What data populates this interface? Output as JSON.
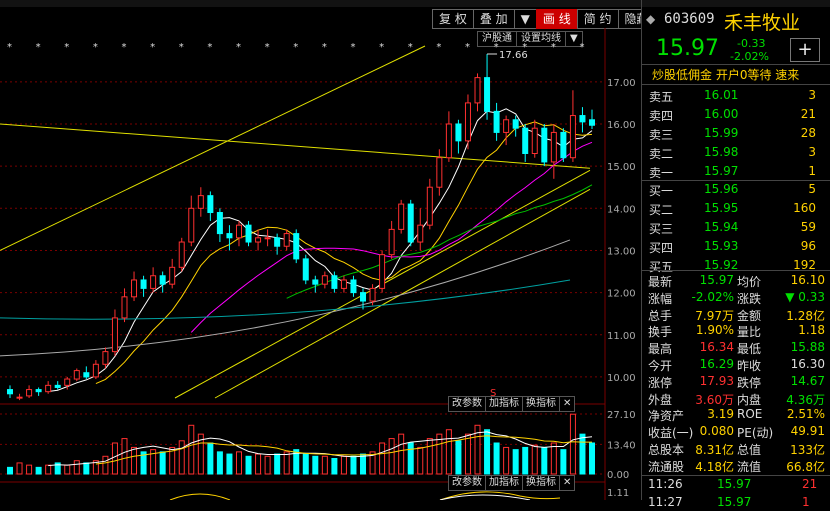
{
  "toolbar": {
    "tabs": [
      {
        "label": "复 权",
        "active": false
      },
      {
        "label": "叠 加",
        "active": false
      },
      {
        "label": "▼",
        "active": false
      },
      {
        "label": "画 线",
        "active": true
      },
      {
        "label": "简 约",
        "active": false
      },
      {
        "label": "隐藏",
        "active": false
      },
      {
        "label": "▶",
        "active": false
      }
    ],
    "subtabs": [
      "沪股通",
      "设置均线",
      "▼"
    ]
  },
  "peak_label": "17.66",
  "marker_label": "S",
  "price_axis": [
    "17.00",
    "16.00",
    "15.00",
    "14.00",
    "13.00",
    "12.00",
    "11.00",
    "10.00"
  ],
  "volume_axis": [
    "27.10",
    "13.40",
    "0.00"
  ],
  "bottom_axis": [
    "1.11"
  ],
  "panel_tabs": {
    "p1": [
      "改参数",
      "加指标",
      "换指标"
    ],
    "p2": [
      "改参数",
      "加指标",
      "换指标"
    ]
  },
  "colors": {
    "up": "#ff3030",
    "down": "#00ffff",
    "ma5": "#ffffff",
    "ma10": "#ffd200",
    "ma20": "#ff00ff",
    "ma60": "#00c000",
    "grid": "#7a0000"
  },
  "chart_data": {
    "type": "candlestick",
    "ylim": [
      9.5,
      17.85
    ],
    "candles": [
      [
        9.7,
        9.6,
        9.8,
        9.5
      ],
      [
        9.5,
        9.52,
        9.6,
        9.45
      ],
      [
        9.55,
        9.7,
        9.8,
        9.5
      ],
      [
        9.7,
        9.65,
        9.75,
        9.55
      ],
      [
        9.65,
        9.8,
        9.9,
        9.6
      ],
      [
        9.8,
        9.75,
        9.9,
        9.7
      ],
      [
        9.8,
        9.95,
        10.0,
        9.7
      ],
      [
        9.95,
        10.15,
        10.2,
        9.9
      ],
      [
        10.1,
        10.0,
        10.25,
        9.95
      ],
      [
        10.0,
        10.3,
        10.4,
        9.95
      ],
      [
        10.3,
        10.6,
        10.7,
        10.2
      ],
      [
        10.6,
        11.4,
        11.6,
        10.5
      ],
      [
        11.4,
        11.9,
        12.1,
        11.3
      ],
      [
        11.9,
        12.3,
        12.5,
        11.8
      ],
      [
        12.3,
        12.1,
        12.4,
        11.9
      ],
      [
        12.1,
        12.4,
        12.6,
        12.0
      ],
      [
        12.4,
        12.2,
        12.5,
        12.0
      ],
      [
        12.2,
        12.6,
        12.8,
        12.1
      ],
      [
        12.6,
        13.2,
        13.3,
        12.5
      ],
      [
        13.2,
        14.0,
        14.3,
        13.1
      ],
      [
        14.0,
        14.3,
        14.5,
        13.8
      ],
      [
        14.3,
        13.9,
        14.4,
        13.7
      ],
      [
        13.9,
        13.4,
        14.0,
        13.2
      ],
      [
        13.4,
        13.3,
        13.6,
        13.0
      ],
      [
        13.3,
        13.6,
        13.7,
        13.1
      ],
      [
        13.6,
        13.2,
        13.7,
        13.1
      ],
      [
        13.2,
        13.3,
        13.5,
        13.0
      ],
      [
        13.3,
        13.3,
        13.5,
        13.1
      ],
      [
        13.3,
        13.1,
        13.4,
        12.9
      ],
      [
        13.1,
        13.4,
        13.5,
        13.0
      ],
      [
        13.4,
        12.8,
        13.5,
        12.7
      ],
      [
        12.8,
        12.3,
        12.9,
        12.2
      ],
      [
        12.3,
        12.2,
        12.4,
        12.0
      ],
      [
        12.2,
        12.4,
        12.5,
        12.1
      ],
      [
        12.4,
        12.1,
        12.5,
        12.0
      ],
      [
        12.1,
        12.3,
        12.4,
        12.0
      ],
      [
        12.3,
        12.0,
        12.4,
        11.9
      ],
      [
        12.0,
        11.8,
        12.1,
        11.6
      ],
      [
        11.8,
        12.1,
        12.2,
        11.7
      ],
      [
        12.1,
        12.9,
        13.0,
        12.0
      ],
      [
        12.9,
        13.5,
        13.7,
        12.8
      ],
      [
        13.5,
        14.1,
        14.2,
        13.4
      ],
      [
        14.1,
        13.2,
        14.2,
        13.1
      ],
      [
        13.2,
        13.6,
        14.0,
        13.0
      ],
      [
        13.6,
        14.5,
        14.7,
        13.5
      ],
      [
        14.5,
        15.2,
        15.4,
        14.3
      ],
      [
        15.2,
        16.0,
        16.3,
        15.1
      ],
      [
        16.0,
        15.6,
        16.1,
        15.3
      ],
      [
        15.6,
        16.5,
        16.7,
        15.4
      ],
      [
        16.5,
        17.1,
        17.2,
        16.3
      ],
      [
        17.1,
        16.3,
        17.66,
        16.1
      ],
      [
        16.3,
        15.8,
        16.5,
        15.6
      ],
      [
        15.8,
        16.1,
        16.2,
        15.5
      ],
      [
        16.1,
        15.9,
        16.2,
        15.7
      ],
      [
        15.9,
        15.3,
        16.0,
        15.1
      ],
      [
        15.3,
        15.9,
        16.1,
        15.2
      ],
      [
        15.9,
        15.1,
        16.0,
        15.0
      ],
      [
        15.1,
        15.8,
        16.0,
        14.7
      ],
      [
        15.8,
        15.2,
        15.9,
        15.1
      ],
      [
        15.2,
        16.2,
        16.8,
        15.1
      ],
      [
        16.2,
        16.05,
        16.4,
        15.8
      ],
      [
        16.1,
        15.97,
        16.34,
        15.88
      ]
    ],
    "volumes": [
      3,
      5,
      4,
      3,
      4,
      5,
      4,
      6,
      5,
      6,
      8,
      14,
      16,
      12,
      10,
      11,
      10,
      12,
      15,
      22,
      18,
      14,
      10,
      9,
      10,
      8,
      9,
      8,
      9,
      10,
      11,
      9,
      8,
      8,
      7,
      8,
      8,
      9,
      10,
      14,
      16,
      18,
      14,
      12,
      16,
      18,
      20,
      15,
      18,
      22,
      20,
      14,
      12,
      11,
      12,
      13,
      12,
      14,
      11,
      27,
      18,
      14
    ]
  },
  "right": {
    "nav": "◆",
    "code": "603609",
    "name": "禾丰牧业",
    "price": "15.97",
    "change": "-0.33",
    "pct": "-2.02%",
    "add": "+",
    "ad": "炒股低佣金 开户0等待 速来",
    "sells": [
      {
        "label": "卖五",
        "price": "16.01",
        "vol": "3"
      },
      {
        "label": "卖四",
        "price": "16.00",
        "vol": "21"
      },
      {
        "label": "卖三",
        "price": "15.99",
        "vol": "28"
      },
      {
        "label": "卖二",
        "price": "15.98",
        "vol": "3"
      },
      {
        "label": "卖一",
        "price": "15.97",
        "vol": "1"
      }
    ],
    "buys": [
      {
        "label": "买一",
        "price": "15.96",
        "vol": "5"
      },
      {
        "label": "买二",
        "price": "15.95",
        "vol": "160"
      },
      {
        "label": "买三",
        "price": "15.94",
        "vol": "59"
      },
      {
        "label": "买四",
        "price": "15.93",
        "vol": "96"
      },
      {
        "label": "买五",
        "price": "15.92",
        "vol": "192"
      }
    ],
    "stats": [
      [
        {
          "k": "最新",
          "v": "15.97",
          "c": "g"
        },
        {
          "k": "均价",
          "v": "16.10",
          "c": "y"
        }
      ],
      [
        {
          "k": "涨幅",
          "v": "-2.02%",
          "c": "g"
        },
        {
          "k": "涨跌",
          "v": "▼ 0.33",
          "c": "g"
        }
      ],
      [
        {
          "k": "总手",
          "v": "7.97万",
          "c": "y"
        },
        {
          "k": "金额",
          "v": "1.28亿",
          "c": "y"
        }
      ],
      [
        {
          "k": "换手",
          "v": "1.90%",
          "c": "y"
        },
        {
          "k": "量比",
          "v": "1.18",
          "c": "y"
        }
      ],
      [
        {
          "k": "最高",
          "v": "16.34",
          "c": "r"
        },
        {
          "k": "最低",
          "v": "15.88",
          "c": "g"
        }
      ],
      [
        {
          "k": "今开",
          "v": "16.29",
          "c": "g"
        },
        {
          "k": "昨收",
          "v": "16.30",
          "c": "w"
        }
      ],
      [
        {
          "k": "涨停",
          "v": "17.93",
          "c": "r"
        },
        {
          "k": "跌停",
          "v": "14.67",
          "c": "g"
        }
      ],
      [
        {
          "k": "外盘",
          "v": "3.60万",
          "c": "r"
        },
        {
          "k": "内盘",
          "v": "4.36万",
          "c": "g"
        }
      ],
      [
        {
          "k": "净资产",
          "v": "3.19",
          "c": "y"
        },
        {
          "k": "ROE",
          "v": "2.51%",
          "c": "y"
        }
      ],
      [
        {
          "k": "收益(一)",
          "v": "0.080",
          "c": "y"
        },
        {
          "k": "PE(动)",
          "v": "49.91",
          "c": "y"
        }
      ],
      [
        {
          "k": "总股本",
          "v": "8.31亿",
          "c": "y"
        },
        {
          "k": "总值",
          "v": "133亿",
          "c": "y"
        }
      ],
      [
        {
          "k": "流通股",
          "v": "4.18亿",
          "c": "y"
        },
        {
          "k": "流值",
          "v": "66.8亿",
          "c": "y"
        }
      ]
    ],
    "ticks": [
      {
        "time": "11:26",
        "price": "15.97",
        "vol": "21"
      },
      {
        "time": "11:27",
        "price": "15.97",
        "vol": "1"
      }
    ]
  }
}
